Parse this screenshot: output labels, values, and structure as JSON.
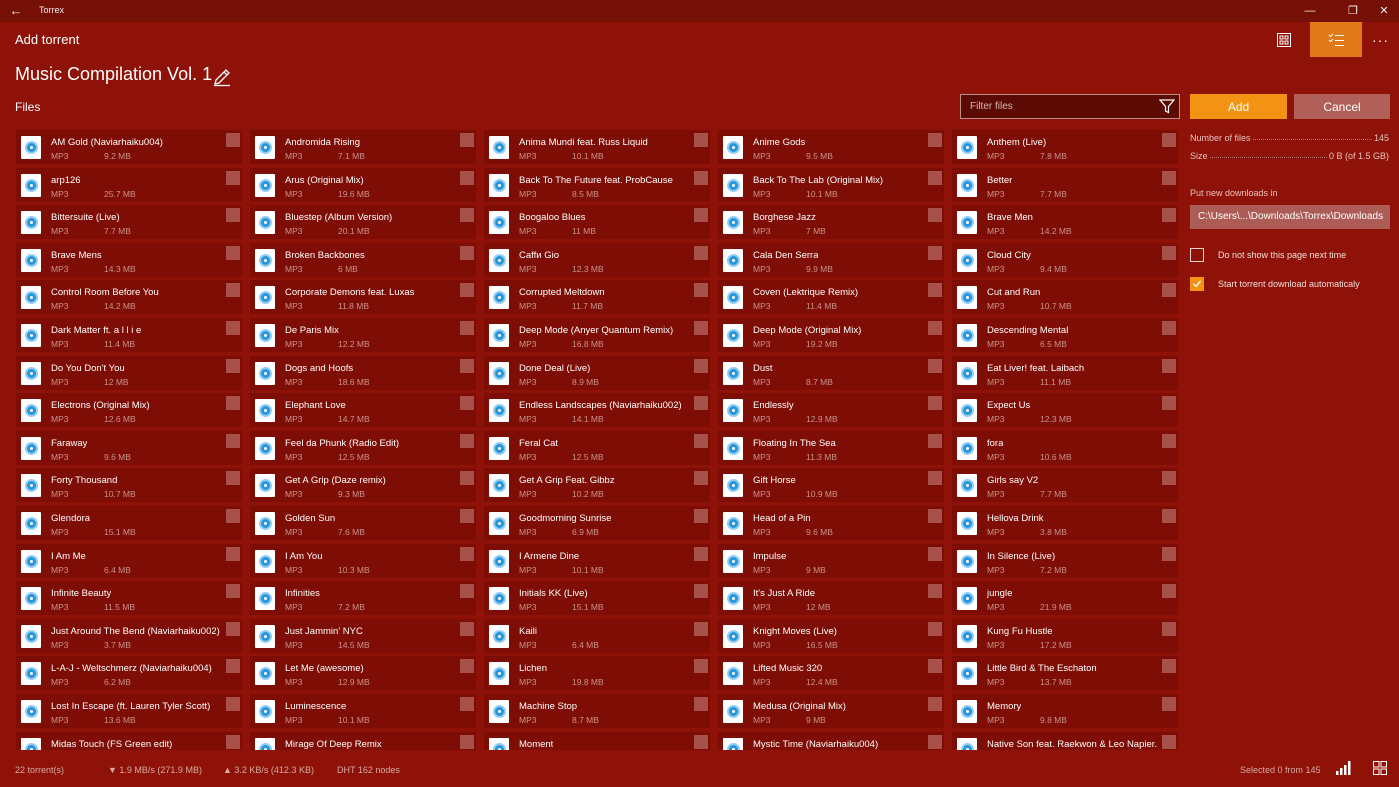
{
  "window": {
    "app_title": "Torrex",
    "back_icon": "back-arrow-icon",
    "minimize_icon": "minimize-icon",
    "maximize_icon": "restore-icon",
    "close_icon": "close-icon"
  },
  "header": {
    "title": "Add torrent",
    "grid_view_icon": "grid-view-icon",
    "list_view_icon": "checklist-view-icon",
    "more_icon": "more-icon"
  },
  "torrent": {
    "name": "Music Compilation Vol. 1",
    "edit_icon": "pencil-icon"
  },
  "files_label": "Files",
  "filter": {
    "placeholder": "Filter files",
    "icon": "filter-icon"
  },
  "buttons": {
    "add": "Add",
    "cancel": "Cancel"
  },
  "info": {
    "files_label": "Number of files",
    "files_value": "145",
    "size_label": "Size",
    "size_value": "0 B (of 1.5 GB)"
  },
  "download_location": {
    "label": "Put new downloads in",
    "path": "C:\\Users\\...\\Downloads\\Torrex\\Downloads"
  },
  "options": [
    {
      "label": "Do not show this page next time",
      "checked": false
    },
    {
      "label": "Start torrent download automaticaly",
      "checked": true
    }
  ],
  "colors": {
    "background": "#8e1208",
    "accent": "#f39313",
    "tile": "#7e0d05",
    "titlebar": "#761006"
  },
  "file_icon": "music-file-icon",
  "files": [
    [
      {
        "name": "AM Gold (Naviarhaiku004)",
        "type": "MP3",
        "size": "9.2 MB"
      },
      {
        "name": "arp126",
        "type": "MP3",
        "size": "25.7 MB"
      },
      {
        "name": "Bittersuite (Live)",
        "type": "MP3",
        "size": "7.7 MB"
      },
      {
        "name": "Brave Mens",
        "type": "MP3",
        "size": "14.3 MB"
      },
      {
        "name": "Control Room Before You",
        "type": "MP3",
        "size": "14.2 MB"
      },
      {
        "name": "Dark Matter ft. a l l i e",
        "type": "MP3",
        "size": "11.4 MB"
      },
      {
        "name": "Do You Don't You",
        "type": "MP3",
        "size": "12 MB"
      },
      {
        "name": "Electrons (Original Mix)",
        "type": "MP3",
        "size": "12.6 MB"
      },
      {
        "name": "Faraway",
        "type": "MP3",
        "size": "9.6 MB"
      },
      {
        "name": "Forty Thousand",
        "type": "MP3",
        "size": "10.7 MB"
      },
      {
        "name": "Glendora",
        "type": "MP3",
        "size": "15.1 MB"
      },
      {
        "name": "I Am Me",
        "type": "MP3",
        "size": "6.4 MB"
      },
      {
        "name": "Infinite Beauty",
        "type": "MP3",
        "size": "11.5 MB"
      },
      {
        "name": "Just Around The Bend (Naviarhaiku002)",
        "type": "MP3",
        "size": "3.7 MB"
      },
      {
        "name": "L-A-J - Weltschmerz (Naviarhaiku004)",
        "type": "MP3",
        "size": "6.2 MB"
      },
      {
        "name": "Lost In Escape (ft. Lauren Tyler Scott)",
        "type": "MP3",
        "size": "13.6 MB"
      },
      {
        "name": "Midas Touch (FS Green edit)",
        "type": "",
        "size": ""
      }
    ],
    [
      {
        "name": "Andromida Rising",
        "type": "MP3",
        "size": "7.1 MB"
      },
      {
        "name": "Arus (Original Mix)",
        "type": "MP3",
        "size": "19.6 MB"
      },
      {
        "name": "Bluestep (Album Version)",
        "type": "MP3",
        "size": "20.1 MB"
      },
      {
        "name": "Broken Backbones",
        "type": "MP3",
        "size": "6 MB"
      },
      {
        "name": "Corporate Demons feat. Luxas",
        "type": "MP3",
        "size": "11.8 MB"
      },
      {
        "name": "De Paris Mix",
        "type": "MP3",
        "size": "12.2 MB"
      },
      {
        "name": "Dogs and Hoofs",
        "type": "MP3",
        "size": "18.6 MB"
      },
      {
        "name": "Elephant Love",
        "type": "MP3",
        "size": "14.7 MB"
      },
      {
        "name": "Feel da Phunk (Radio Edit)",
        "type": "MP3",
        "size": "12.5 MB"
      },
      {
        "name": "Get A Grip (Daze remix)",
        "type": "MP3",
        "size": "9.3 MB"
      },
      {
        "name": "Golden Sun",
        "type": "MP3",
        "size": "7.6 MB"
      },
      {
        "name": "I Am You",
        "type": "MP3",
        "size": "10.3 MB"
      },
      {
        "name": "Infinities",
        "type": "MP3",
        "size": "7.2 MB"
      },
      {
        "name": "Just Jammin' NYC",
        "type": "MP3",
        "size": "14.5 MB"
      },
      {
        "name": "Let Me (awesome)",
        "type": "MP3",
        "size": "12.9 MB"
      },
      {
        "name": "Luminescence",
        "type": "MP3",
        "size": "10.1 MB"
      },
      {
        "name": "Mirage Of Deep Remix",
        "type": "",
        "size": ""
      }
    ],
    [
      {
        "name": "Anima Mundi feat. Russ Liquid",
        "type": "MP3",
        "size": "10.1 MB"
      },
      {
        "name": "Back To The Future feat. ProbCause",
        "type": "MP3",
        "size": "8.5 MB"
      },
      {
        "name": "Boogaloo Blues",
        "type": "MP3",
        "size": "11 MB"
      },
      {
        "name": "Caffи Gio",
        "type": "MP3",
        "size": "12.3 MB"
      },
      {
        "name": "Corrupted Meltdown",
        "type": "MP3",
        "size": "11.7 MB"
      },
      {
        "name": "Deep Mode (Anyer Quantum Remix)",
        "type": "MP3",
        "size": "16.8 MB"
      },
      {
        "name": "Done Deal (Live)",
        "type": "MP3",
        "size": "8.9 MB"
      },
      {
        "name": "Endless Landscapes (Naviarhaiku002)",
        "type": "MP3",
        "size": "14.1 MB"
      },
      {
        "name": "Feral Cat",
        "type": "MP3",
        "size": "12.5 MB"
      },
      {
        "name": "Get A Grip Feat. Gibbz",
        "type": "MP3",
        "size": "10.2 MB"
      },
      {
        "name": "Goodmorning Sunrise",
        "type": "MP3",
        "size": "6.9 MB"
      },
      {
        "name": "I Armene Dine",
        "type": "MP3",
        "size": "10.1 MB"
      },
      {
        "name": "Initials KK (Live)",
        "type": "MP3",
        "size": "15.1 MB"
      },
      {
        "name": "Kaili",
        "type": "MP3",
        "size": "6.4 MB"
      },
      {
        "name": "Lichen",
        "type": "MP3",
        "size": "19.8 MB"
      },
      {
        "name": "Machine Stop",
        "type": "MP3",
        "size": "8.7 MB"
      },
      {
        "name": "Moment",
        "type": "",
        "size": ""
      }
    ],
    [
      {
        "name": "Anime Gods",
        "type": "MP3",
        "size": "9.5 MB"
      },
      {
        "name": "Back To The Lab (Original Mix)",
        "type": "MP3",
        "size": "10.1 MB"
      },
      {
        "name": "Borghese Jazz",
        "type": "MP3",
        "size": "7 MB"
      },
      {
        "name": "Cala Den Serra",
        "type": "MP3",
        "size": "9.9 MB"
      },
      {
        "name": "Coven (Lektrique Remix)",
        "type": "MP3",
        "size": "11.4 MB"
      },
      {
        "name": "Deep Mode (Original Mix)",
        "type": "MP3",
        "size": "19.2 MB"
      },
      {
        "name": "Dust",
        "type": "MP3",
        "size": "8.7 MB"
      },
      {
        "name": "Endlessly",
        "type": "MP3",
        "size": "12.9 MB"
      },
      {
        "name": "Floating In The Sea",
        "type": "MP3",
        "size": "11.3 MB"
      },
      {
        "name": "Gift Horse",
        "type": "MP3",
        "size": "10.9 MB"
      },
      {
        "name": "Head of a Pin",
        "type": "MP3",
        "size": "9.6 MB"
      },
      {
        "name": "Impulse",
        "type": "MP3",
        "size": "9 MB"
      },
      {
        "name": "It's Just A Ride",
        "type": "MP3",
        "size": "12 MB"
      },
      {
        "name": "Knight Moves (Live)",
        "type": "MP3",
        "size": "16.5 MB"
      },
      {
        "name": "Lifted Music 320",
        "type": "MP3",
        "size": "12.4 MB"
      },
      {
        "name": "Medusa (Original Mix)",
        "type": "MP3",
        "size": "9 MB"
      },
      {
        "name": "Mystic Time (Naviarhaiku004)",
        "type": "",
        "size": ""
      }
    ],
    [
      {
        "name": "Anthem (Live)",
        "type": "MP3",
        "size": "7.8 MB"
      },
      {
        "name": "Better",
        "type": "MP3",
        "size": "7.7 MB"
      },
      {
        "name": "Brave Men",
        "type": "MP3",
        "size": "14.2 MB"
      },
      {
        "name": "Cloud City",
        "type": "MP3",
        "size": "9.4 MB"
      },
      {
        "name": "Cut and Run",
        "type": "MP3",
        "size": "10.7 MB"
      },
      {
        "name": "Descending Mental",
        "type": "MP3",
        "size": "6.5 MB"
      },
      {
        "name": "Eat Liver! feat. Laibach",
        "type": "MP3",
        "size": "11.1 MB"
      },
      {
        "name": "Expect Us",
        "type": "MP3",
        "size": "12.3 MB"
      },
      {
        "name": "fora",
        "type": "MP3",
        "size": "10.6 MB"
      },
      {
        "name": "Girls say V2",
        "type": "MP3",
        "size": "7.7 MB"
      },
      {
        "name": "Hellova Drink",
        "type": "MP3",
        "size": "3.8 MB"
      },
      {
        "name": "In Silence (Live)",
        "type": "MP3",
        "size": "7.2 MB"
      },
      {
        "name": "jungle",
        "type": "MP3",
        "size": "21.9 MB"
      },
      {
        "name": "Kung Fu Hustle",
        "type": "MP3",
        "size": "17.2 MB"
      },
      {
        "name": "Little Bird & The Eschaton",
        "type": "MP3",
        "size": "13.7 MB"
      },
      {
        "name": "Memory",
        "type": "MP3",
        "size": "9.8 MB"
      },
      {
        "name": "Native Son feat. Raekwon & Leo Napier...",
        "type": "",
        "size": ""
      }
    ]
  ],
  "status": {
    "torrents": "22 torrent(s)",
    "download": "▼ 1.9 MB/s (271.9 MB)",
    "upload": "▲ 3.2 KB/s (412.3 KB)",
    "dht": "DHT 162 nodes",
    "selected": "Selected 0 from 145",
    "signal_icon": "signal-bars-icon",
    "tiles_icon": "tiles-icon"
  }
}
